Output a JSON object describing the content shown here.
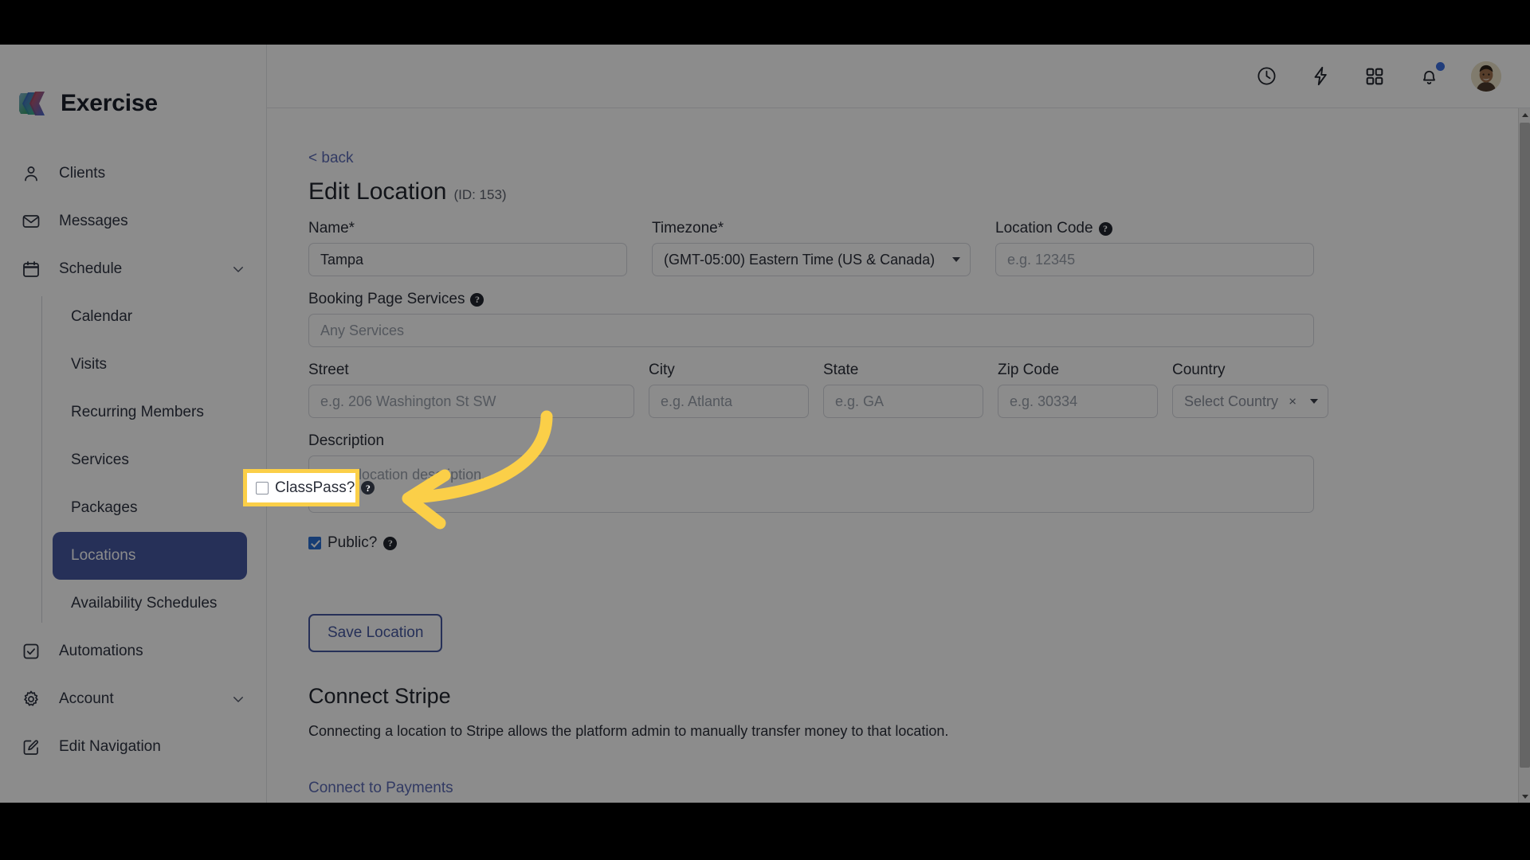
{
  "brand": {
    "name": "Exercise",
    "logo_icon": "exercise-logo-icon"
  },
  "header": {
    "icons": [
      {
        "name": "clock-icon",
        "label": "Recent"
      },
      {
        "name": "lightning-icon",
        "label": "Quick Actions"
      },
      {
        "name": "grid-apps-icon",
        "label": "Apps"
      },
      {
        "name": "bell-icon",
        "label": "Notifications",
        "has_dot": true
      }
    ],
    "avatar_name": "user-avatar",
    "notification_dot_color": "#3d6fe0"
  },
  "sidebar": {
    "items": [
      {
        "label": "Clients",
        "icon": "person-icon",
        "expandable": false
      },
      {
        "label": "Messages",
        "icon": "envelope-icon",
        "expandable": false
      },
      {
        "label": "Schedule",
        "icon": "calendar-icon",
        "expandable": true,
        "expanded": true
      }
    ],
    "schedule_subitems": [
      {
        "label": "Calendar",
        "active": false
      },
      {
        "label": "Visits",
        "active": false
      },
      {
        "label": "Recurring Members",
        "active": false
      },
      {
        "label": "Services",
        "active": false
      },
      {
        "label": "Packages",
        "active": false
      },
      {
        "label": "Locations",
        "active": true
      },
      {
        "label": "Availability Schedules",
        "active": false
      }
    ],
    "bottom_items": [
      {
        "label": "Automations",
        "icon": "checkbox-square-icon",
        "expandable": false
      },
      {
        "label": "Account",
        "icon": "gear-icon",
        "expandable": true
      },
      {
        "label": "Edit Navigation",
        "icon": "pencil-square-icon",
        "expandable": false
      }
    ],
    "active_color": "#4558a0"
  },
  "main": {
    "back_label": "< back",
    "title": "Edit Location",
    "title_id": "(ID: 153)",
    "fields": {
      "name": {
        "label": "Name*",
        "value": "Tampa",
        "placeholder": ""
      },
      "timezone": {
        "label": "Timezone*",
        "value": "(GMT-05:00) Eastern Time (US & Canada)"
      },
      "location_code": {
        "label": "Location Code",
        "value": "",
        "placeholder": "e.g. 12345",
        "has_help": true
      },
      "booking_page_services": {
        "label": "Booking Page Services",
        "value": "",
        "placeholder": "Any Services",
        "has_help": true
      },
      "street": {
        "label": "Street",
        "value": "",
        "placeholder": "e.g. 206 Washington St SW"
      },
      "city": {
        "label": "City",
        "value": "",
        "placeholder": "e.g. Atlanta"
      },
      "state": {
        "label": "State",
        "value": "",
        "placeholder": "e.g. GA"
      },
      "zip": {
        "label": "Zip Code",
        "value": "",
        "placeholder": "e.g. 30334"
      },
      "country": {
        "label": "Country",
        "value": "Select Country",
        "clear_glyph": "×"
      },
      "description": {
        "label": "Description",
        "value": "",
        "placeholder": "Enter location description."
      }
    },
    "checkboxes": {
      "public": {
        "label": "Public?",
        "checked": true,
        "has_help": true
      },
      "classpass": {
        "label": "ClassPass?",
        "checked": false,
        "has_help": true
      }
    },
    "save_button": "Save Location",
    "stripe": {
      "title": "Connect Stripe",
      "description": "Connecting a location to Stripe allows the platform admin to manually transfer money to that location.",
      "link": "Connect to Payments"
    }
  },
  "annotation": {
    "highlight_target": "classpass-checkbox",
    "highlight_color": "#fbcf48",
    "arrow_color": "#fbcf48",
    "arrow_direction": "left"
  }
}
